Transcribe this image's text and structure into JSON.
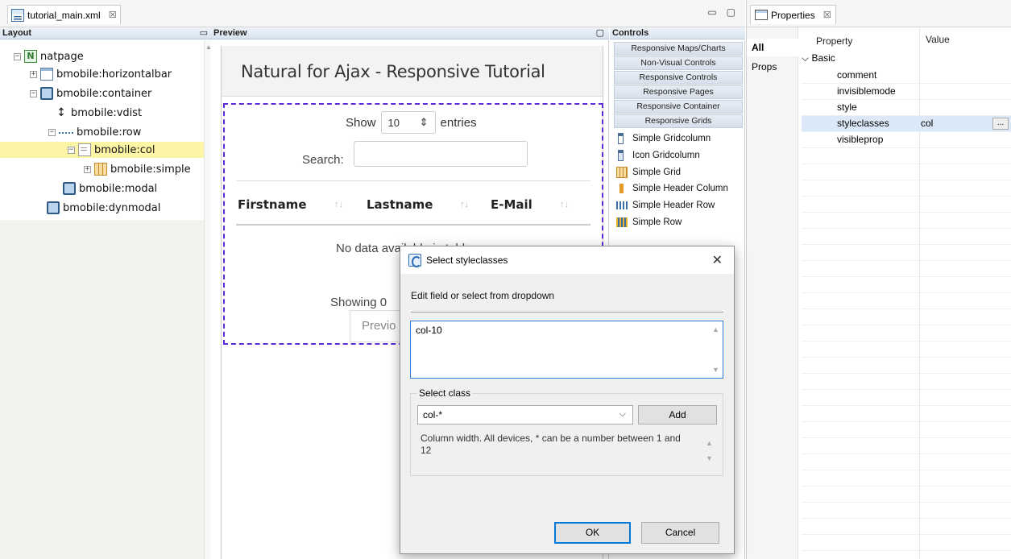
{
  "editor": {
    "tab_label": "tutorial_main.xml",
    "tab_close": "☒",
    "minimize": "▭",
    "maximize": "▢"
  },
  "layout": {
    "header": "Layout",
    "minimize": "▭",
    "tree": [
      {
        "label": "natpage",
        "icon": "natpage-icon",
        "expander": "−"
      },
      {
        "label": "bmobile:horizontalbar",
        "icon": "horizontalbar-icon",
        "expander": "+"
      },
      {
        "label": "bmobile:container",
        "icon": "container-icon",
        "expander": "−"
      },
      {
        "label": "bmobile:vdist",
        "icon": "vdist-icon"
      },
      {
        "label": "bmobile:row",
        "icon": "row-icon",
        "expander": "−"
      },
      {
        "label": "bmobile:col",
        "icon": "col-icon",
        "expander": "−",
        "selected": true
      },
      {
        "label": "bmobile:simple",
        "icon": "grid-icon",
        "expander": "+"
      },
      {
        "label": "bmobile:modal",
        "icon": "container-icon"
      },
      {
        "label": "bmobile:dynmodal",
        "icon": "container-icon"
      }
    ]
  },
  "preview": {
    "header": "Preview",
    "title": "Natural for Ajax - Responsive Tutorial",
    "show_label": "Show",
    "entries_value": "10",
    "entries_label": "entries",
    "search_label": "Search:",
    "columns": [
      "Firstname",
      "Lastname",
      "E-Mail"
    ],
    "sort_glyph": "↑↓",
    "empty_text": "No data available in table",
    "info_text": "Showing 0",
    "prev_label": "Previo"
  },
  "controls": {
    "header": "Controls",
    "categories": [
      "Responsive Maps/Charts",
      "Non-Visual Controls",
      "Responsive Controls",
      "Responsive Pages",
      "Responsive Container",
      "Responsive Grids"
    ],
    "items": [
      "Simple Gridcolumn",
      "Icon Gridcolumn",
      "Simple Grid",
      "Simple Header Column",
      "Simple Header Row",
      "Simple Row"
    ]
  },
  "properties": {
    "tab_label": "Properties",
    "tab_close": "☒",
    "side_tabs": [
      "All",
      "Props"
    ],
    "col_property": "Property",
    "col_value": "Value",
    "category": "Basic",
    "rows": [
      {
        "name": "comment",
        "value": ""
      },
      {
        "name": "invisiblemode",
        "value": ""
      },
      {
        "name": "style",
        "value": ""
      },
      {
        "name": "styleclasses",
        "value": "col",
        "selected": true
      },
      {
        "name": "visibleprop",
        "value": ""
      }
    ],
    "ellipsis": "..."
  },
  "dialog": {
    "title": "Select styleclasses",
    "close": "✕",
    "description": "Edit field or select from dropdown",
    "text_value": "col-10",
    "group_label": "Select class",
    "combo_value": "col-*",
    "add_label": "Add",
    "info": "Column width. All devices, * can be a number between 1 and 12",
    "ok_label": "OK",
    "cancel_label": "Cancel"
  }
}
